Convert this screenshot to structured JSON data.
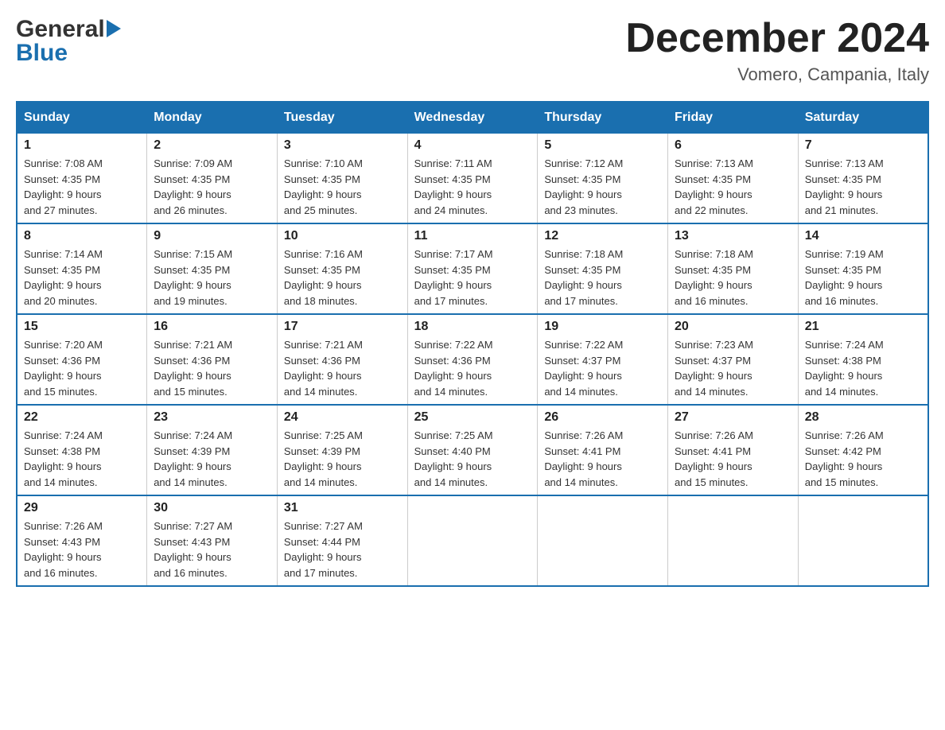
{
  "header": {
    "logo_general": "General",
    "logo_blue": "Blue",
    "month_title": "December 2024",
    "location": "Vomero, Campania, Italy"
  },
  "calendar": {
    "days_of_week": [
      "Sunday",
      "Monday",
      "Tuesday",
      "Wednesday",
      "Thursday",
      "Friday",
      "Saturday"
    ],
    "weeks": [
      [
        {
          "day": "1",
          "sunrise": "7:08 AM",
          "sunset": "4:35 PM",
          "daylight": "9 hours and 27 minutes."
        },
        {
          "day": "2",
          "sunrise": "7:09 AM",
          "sunset": "4:35 PM",
          "daylight": "9 hours and 26 minutes."
        },
        {
          "day": "3",
          "sunrise": "7:10 AM",
          "sunset": "4:35 PM",
          "daylight": "9 hours and 25 minutes."
        },
        {
          "day": "4",
          "sunrise": "7:11 AM",
          "sunset": "4:35 PM",
          "daylight": "9 hours and 24 minutes."
        },
        {
          "day": "5",
          "sunrise": "7:12 AM",
          "sunset": "4:35 PM",
          "daylight": "9 hours and 23 minutes."
        },
        {
          "day": "6",
          "sunrise": "7:13 AM",
          "sunset": "4:35 PM",
          "daylight": "9 hours and 22 minutes."
        },
        {
          "day": "7",
          "sunrise": "7:13 AM",
          "sunset": "4:35 PM",
          "daylight": "9 hours and 21 minutes."
        }
      ],
      [
        {
          "day": "8",
          "sunrise": "7:14 AM",
          "sunset": "4:35 PM",
          "daylight": "9 hours and 20 minutes."
        },
        {
          "day": "9",
          "sunrise": "7:15 AM",
          "sunset": "4:35 PM",
          "daylight": "9 hours and 19 minutes."
        },
        {
          "day": "10",
          "sunrise": "7:16 AM",
          "sunset": "4:35 PM",
          "daylight": "9 hours and 18 minutes."
        },
        {
          "day": "11",
          "sunrise": "7:17 AM",
          "sunset": "4:35 PM",
          "daylight": "9 hours and 17 minutes."
        },
        {
          "day": "12",
          "sunrise": "7:18 AM",
          "sunset": "4:35 PM",
          "daylight": "9 hours and 17 minutes."
        },
        {
          "day": "13",
          "sunrise": "7:18 AM",
          "sunset": "4:35 PM",
          "daylight": "9 hours and 16 minutes."
        },
        {
          "day": "14",
          "sunrise": "7:19 AM",
          "sunset": "4:35 PM",
          "daylight": "9 hours and 16 minutes."
        }
      ],
      [
        {
          "day": "15",
          "sunrise": "7:20 AM",
          "sunset": "4:36 PM",
          "daylight": "9 hours and 15 minutes."
        },
        {
          "day": "16",
          "sunrise": "7:21 AM",
          "sunset": "4:36 PM",
          "daylight": "9 hours and 15 minutes."
        },
        {
          "day": "17",
          "sunrise": "7:21 AM",
          "sunset": "4:36 PM",
          "daylight": "9 hours and 14 minutes."
        },
        {
          "day": "18",
          "sunrise": "7:22 AM",
          "sunset": "4:36 PM",
          "daylight": "9 hours and 14 minutes."
        },
        {
          "day": "19",
          "sunrise": "7:22 AM",
          "sunset": "4:37 PM",
          "daylight": "9 hours and 14 minutes."
        },
        {
          "day": "20",
          "sunrise": "7:23 AM",
          "sunset": "4:37 PM",
          "daylight": "9 hours and 14 minutes."
        },
        {
          "day": "21",
          "sunrise": "7:24 AM",
          "sunset": "4:38 PM",
          "daylight": "9 hours and 14 minutes."
        }
      ],
      [
        {
          "day": "22",
          "sunrise": "7:24 AM",
          "sunset": "4:38 PM",
          "daylight": "9 hours and 14 minutes."
        },
        {
          "day": "23",
          "sunrise": "7:24 AM",
          "sunset": "4:39 PM",
          "daylight": "9 hours and 14 minutes."
        },
        {
          "day": "24",
          "sunrise": "7:25 AM",
          "sunset": "4:39 PM",
          "daylight": "9 hours and 14 minutes."
        },
        {
          "day": "25",
          "sunrise": "7:25 AM",
          "sunset": "4:40 PM",
          "daylight": "9 hours and 14 minutes."
        },
        {
          "day": "26",
          "sunrise": "7:26 AM",
          "sunset": "4:41 PM",
          "daylight": "9 hours and 14 minutes."
        },
        {
          "day": "27",
          "sunrise": "7:26 AM",
          "sunset": "4:41 PM",
          "daylight": "9 hours and 15 minutes."
        },
        {
          "day": "28",
          "sunrise": "7:26 AM",
          "sunset": "4:42 PM",
          "daylight": "9 hours and 15 minutes."
        }
      ],
      [
        {
          "day": "29",
          "sunrise": "7:26 AM",
          "sunset": "4:43 PM",
          "daylight": "9 hours and 16 minutes."
        },
        {
          "day": "30",
          "sunrise": "7:27 AM",
          "sunset": "4:43 PM",
          "daylight": "9 hours and 16 minutes."
        },
        {
          "day": "31",
          "sunrise": "7:27 AM",
          "sunset": "4:44 PM",
          "daylight": "9 hours and 17 minutes."
        },
        null,
        null,
        null,
        null
      ]
    ],
    "labels": {
      "sunrise": "Sunrise:",
      "sunset": "Sunset:",
      "daylight": "Daylight:"
    }
  }
}
